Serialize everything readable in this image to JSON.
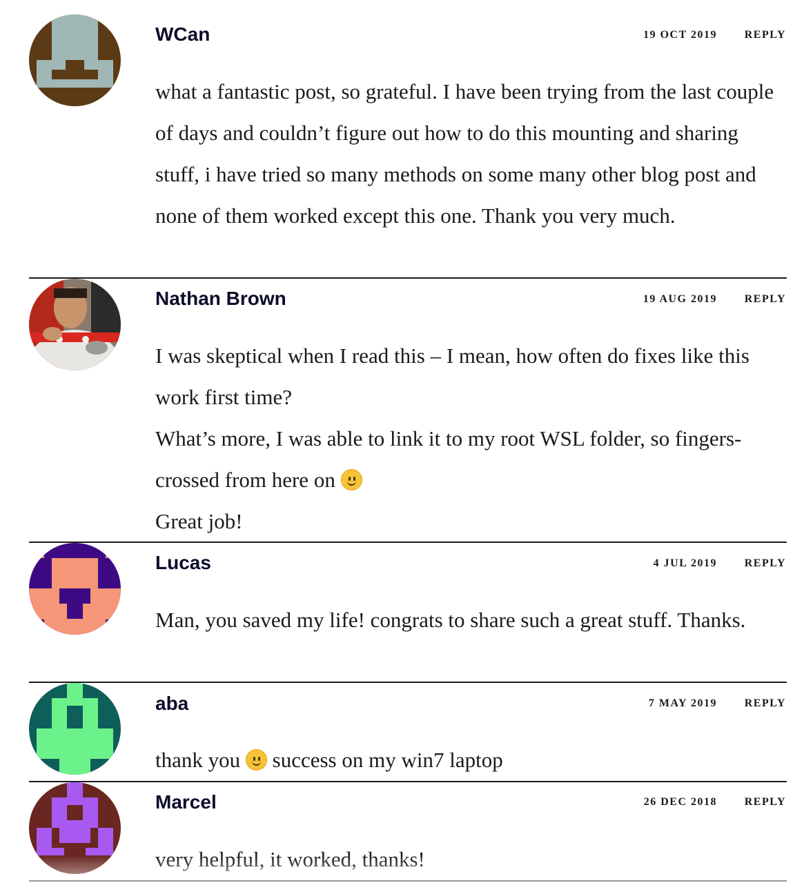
{
  "comments": [
    {
      "author": "WCan",
      "date": "19 OCT 2019",
      "reply": "REPLY",
      "avatar": {
        "icon": "identicon-avatar",
        "bg": "#5b3a16",
        "fg": "#9fb8b5"
      },
      "paragraphs": [
        {
          "text": "what a fantastic post, so grateful. I have been trying from the last couple of days and couldn’t figure out how to do this mounting and sharing stuff, i have tried so many methods on some many other blog post and none of them worked except this one. Thank you very much."
        }
      ]
    },
    {
      "author": "Nathan Brown",
      "date": "19 AUG 2019",
      "reply": "REPLY",
      "avatar": {
        "icon": "photo-avatar",
        "bg": "#c9c4bd",
        "fg": "#d8281f"
      },
      "paragraphs": [
        {
          "text": "I was skeptical when I read this – I mean, how often do fixes like this work first time?"
        },
        {
          "text": "What’s more, I was able to link it to my root WSL folder, so fingers-crossed from here on",
          "emoji": "slightly-smiling-face-icon"
        },
        {
          "text": "Great job!"
        }
      ]
    },
    {
      "author": "Lucas",
      "date": "4 JUL 2019",
      "reply": "REPLY",
      "avatar": {
        "icon": "identicon-avatar",
        "bg": "#3d0a84",
        "fg": "#f49677"
      },
      "paragraphs": [
        {
          "text": "Man, you saved my life! congrats to share such a great stuff. Thanks."
        }
      ]
    },
    {
      "author": "aba",
      "date": "7 MAY 2019",
      "reply": "REPLY",
      "avatar": {
        "icon": "identicon-avatar",
        "bg": "#0e5e5a",
        "fg": "#6cf28a"
      },
      "paragraphs": [
        {
          "text": "thank you",
          "emoji": "slightly-smiling-face-icon",
          "after": "success on my win7 laptop"
        }
      ]
    },
    {
      "author": "Marcel",
      "date": "26 DEC 2018",
      "reply": "REPLY",
      "avatar": {
        "icon": "identicon-avatar",
        "bg": "#6a2620",
        "fg": "#a85af0"
      },
      "paragraphs": [
        {
          "text": "very helpful, it worked, thanks!"
        }
      ]
    }
  ]
}
